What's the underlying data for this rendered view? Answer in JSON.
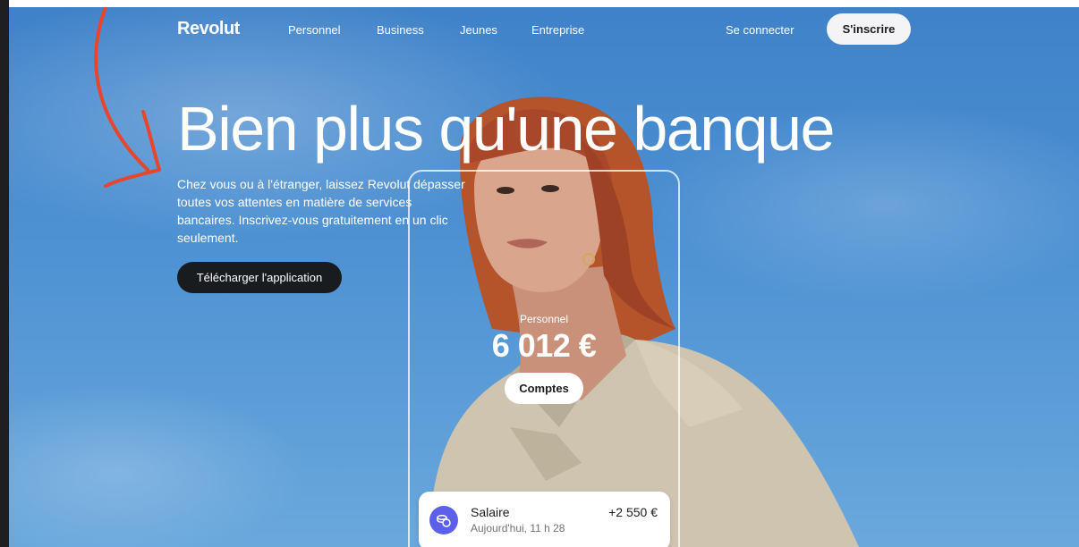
{
  "nav": {
    "logo": "Revolut",
    "links": [
      "Personnel",
      "Business",
      "Jeunes",
      "Entreprise"
    ],
    "login_label": "Se connecter",
    "signup_label": "S'inscrire"
  },
  "hero": {
    "headline": "Bien plus qu'une banque",
    "subtext": "Chez vous ou à l'étranger, laissez Revolut dépasser toutes vos attentes en matière de services bancaires. Inscrivez-vous gratuitement en un clic seulement.",
    "download_label": "Télécharger l'application"
  },
  "account": {
    "label": "Personnel",
    "balance": "6 012 €",
    "accounts_label": "Comptes"
  },
  "transaction": {
    "title": "Salaire",
    "time": "Aujourd'hui, 11 h 28",
    "amount": "+2 550 €",
    "icon": "coins-icon"
  },
  "colors": {
    "sky": "#4e92d3",
    "dark_button": "#191c1f",
    "annotation_arrow": "#e8452c",
    "txn_icon_bg": "#5b5fea"
  }
}
